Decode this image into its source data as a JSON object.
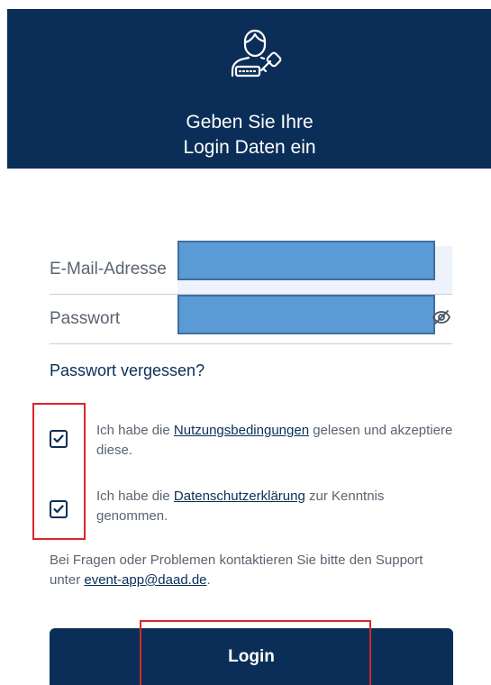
{
  "header": {
    "icon": "user-key-icon",
    "title_line1": "Geben Sie Ihre",
    "title_line2": "Login Daten ein",
    "background": "#0a2e57"
  },
  "form": {
    "email_label": "E-Mail-Adresse",
    "email_value": "",
    "password_label": "Passwort",
    "password_value": "",
    "show_password_icon": "eye-slash-icon",
    "forgot_password": "Passwort vergessen?"
  },
  "terms": {
    "checked": true,
    "prefix": "Ich habe die ",
    "link": "Nutzungsbedingungen",
    "suffix": " gelesen und akzeptiere diese."
  },
  "privacy": {
    "checked": true,
    "prefix": "Ich habe die ",
    "link": "Datenschutzerklärung",
    "suffix": " zur Kenntnis genommen."
  },
  "support": {
    "text": "Bei Fragen oder Problemen kontaktieren Sie bitte den Support unter ",
    "email": "event-app@daad.de",
    "end": "."
  },
  "login_button": "Login",
  "colors": {
    "primary": "#0a2e57",
    "annotation_red": "#d9262c",
    "redaction_blue": "#5b9bd5"
  }
}
